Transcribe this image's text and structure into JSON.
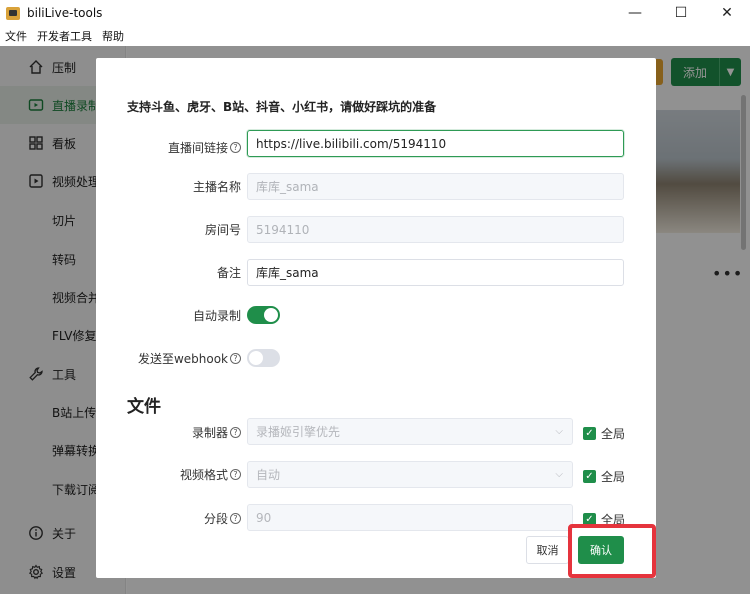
{
  "window": {
    "title": "biliLive-tools",
    "minimize": "—",
    "maximize": "☐",
    "close": "✕"
  },
  "menu": [
    "文件",
    "开发者工具",
    "帮助"
  ],
  "sidebar": {
    "items": [
      {
        "label": "压制",
        "icon": "home-icon"
      },
      {
        "label": "直播录制",
        "icon": "tv-icon",
        "active": true
      },
      {
        "label": "看板",
        "icon": "grid-icon"
      },
      {
        "label": "视频处理",
        "icon": "play-icon"
      },
      {
        "label": "切片",
        "sub": true
      },
      {
        "label": "转码",
        "sub": true
      },
      {
        "label": "视频合并",
        "sub": true
      },
      {
        "label": "FLV修复",
        "sub": true
      },
      {
        "label": "工具",
        "icon": "wrench-icon"
      },
      {
        "label": "B站上传",
        "sub": true
      },
      {
        "label": "弹幕转换",
        "sub": true
      },
      {
        "label": "下载订阅",
        "sub": true
      },
      {
        "label": "关于",
        "icon": "info-icon"
      },
      {
        "label": "设置",
        "icon": "gear-icon"
      }
    ]
  },
  "main": {
    "add_button": "添加",
    "more_icon": "•••"
  },
  "dialog": {
    "heading": "支持斗鱼、虎牙、B站、抖音、小红书，请做好踩坑的准备",
    "fields": {
      "live_url": {
        "label": "直播间链接",
        "value": "https://live.bilibili.com/5194110"
      },
      "streamer": {
        "label": "主播名称",
        "value": "库库_sama"
      },
      "room_id": {
        "label": "房间号",
        "value": "5194110"
      },
      "remark": {
        "label": "备注",
        "value": "库库_sama"
      },
      "auto_record": {
        "label": "自动录制",
        "on": true
      },
      "webhook": {
        "label": "发送至webhook",
        "on": false
      }
    },
    "section_file": "文件",
    "file_fields": {
      "recorder": {
        "label": "录制器",
        "value": "录播姬引擎优先",
        "global_label": "全局"
      },
      "format": {
        "label": "视频格式",
        "value": "自动",
        "global_label": "全局"
      },
      "segment": {
        "label": "分段",
        "value": "90",
        "global_label": "全局"
      }
    },
    "cancel": "取消",
    "confirm": "确认"
  },
  "colors": {
    "accent": "#1f8e4a",
    "highlight": "#e5343d"
  }
}
